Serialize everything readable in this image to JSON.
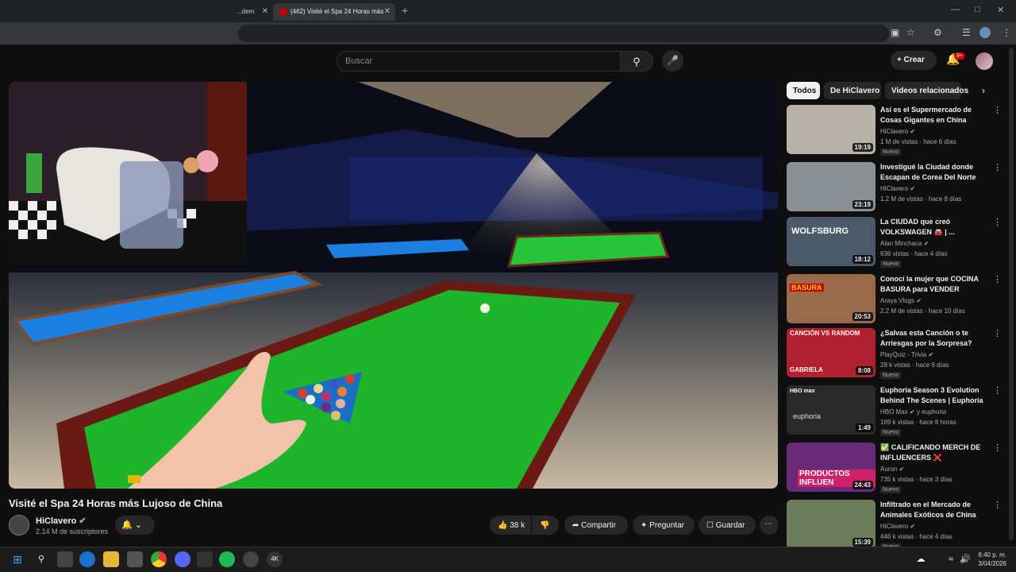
{
  "browser": {
    "tabs": [
      {
        "label": "...dem"
      },
      {
        "label": "(462) Visité el Spa 24 Horas más"
      }
    ],
    "close_glyph": "✕",
    "newtab_glyph": "+"
  },
  "header": {
    "search_placeholder": "Buscar",
    "create_label": "Crear",
    "notif_count": "9+"
  },
  "video": {
    "title": "Visité el Spa 24 Horas más Lujoso de China",
    "channel": "HiClavero",
    "subscribers": "2.14 M de suscriptores",
    "likes": "38 k",
    "share_label": "Compartir",
    "ask_label": "Preguntar",
    "save_label": "Guardar"
  },
  "chips": [
    "Todos",
    "De HiClavero",
    "Videos relacionados"
  ],
  "recommendations": [
    {
      "title": "Así es el Supermercado de Cosas Gigantes en China",
      "channel": "HiClavero",
      "meta": "1 M de vistas · hace 6 días",
      "duration": "19:19",
      "badge": "Nuevo",
      "color": "#b9b2a8"
    },
    {
      "title": "Investigué la Ciudad donde Escapan de Corea Del Norte",
      "channel": "HiClavero",
      "meta": "1.2 M de vistas · hace 8 días",
      "duration": "23:19",
      "badge": "",
      "color": "#8a8f94"
    },
    {
      "title": "La CIUDAD que creó VOLKSWAGEN 🚘 | ...",
      "channel": "Alan Minchaca",
      "meta": "636 vistas · hace 4 días",
      "duration": "18:12",
      "badge": "Nuevo",
      "color": "#4b5a6b"
    },
    {
      "title": "Conocí la mujer que COCINA BASURA para VENDER COMIDA",
      "channel": "Araya Vlogs",
      "meta": "2.2 M de vistas · hace 10 días",
      "duration": "20:53",
      "badge": "",
      "color": "#9a6a4a"
    },
    {
      "title": "¿Salvas esta Canción o te Arriesgas por la Sorpresa? 🎵...",
      "channel": "PlayQuiz - Trivia",
      "meta": "28 k vistas · hace 6 días",
      "duration": "8:08",
      "badge": "Nuevo",
      "color": "#b02030"
    },
    {
      "title": "Euphoria Season 3 Evolution Behind The Scenes | Euphoria ...",
      "channel": "HBO Max",
      "channel_extra": "y euphoria",
      "meta": "169 k vistas · hace 8 horas",
      "duration": "1:49",
      "badge": "Nuevo",
      "color": "#2a2a2a"
    },
    {
      "title": "✅ CALIFICANDO MERCH DE INFLUENCERS ❌",
      "channel": "Auron",
      "meta": "735 k vistas · hace 3 días",
      "duration": "24:43",
      "badge": "Nuevo",
      "color": "#6a2a7a"
    },
    {
      "title": "Infiltrado en el Mercado de Animales Exóticos de China",
      "channel": "HiClavero",
      "meta": "446 k vistas · hace 4 días",
      "duration": "15:39",
      "badge": "Nuevo",
      "color": "#6b7d5a"
    }
  ],
  "thumb_texts": {
    "r2": "WOLFSBURG",
    "r3": "BASURA",
    "r4": "CANCIÓN VS RANDOM",
    "r4b": "GABRIELA",
    "r5": "HBO max",
    "r5b": "euphoria",
    "r6": "PRODUCTOS INFLUEN"
  },
  "taskbar": {
    "time": "6:40 p. m.",
    "date": "3/04/2026"
  },
  "colors": {
    "accent_red": "#cc0000",
    "felt_green": "#1fb52b"
  }
}
